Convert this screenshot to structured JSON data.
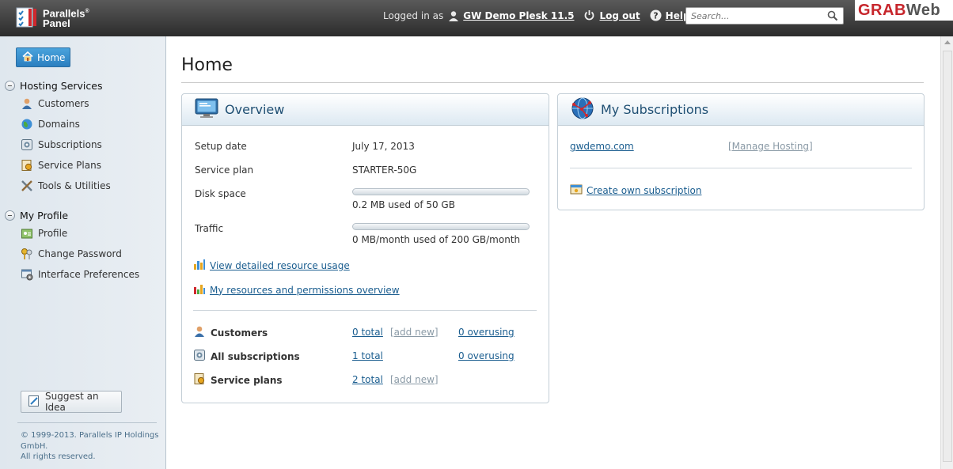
{
  "header": {
    "brand_line1": "Parallels",
    "brand_line2": "Panel",
    "logged_in_label": "Logged in as",
    "user_name": "GW Demo Plesk 11.5",
    "logout_label": "Log out",
    "help_label": "Help",
    "search_placeholder": "Search...",
    "watermark_a": "GRAB",
    "watermark_b": "Web"
  },
  "sidebar": {
    "home_label": "Home",
    "groups": [
      {
        "title": "Hosting Services",
        "items": [
          {
            "label": "Customers",
            "icon": "customer-icon"
          },
          {
            "label": "Domains",
            "icon": "globe-icon"
          },
          {
            "label": "Subscriptions",
            "icon": "subscription-icon"
          },
          {
            "label": "Service Plans",
            "icon": "plan-icon"
          },
          {
            "label": "Tools & Utilities",
            "icon": "tools-icon"
          }
        ]
      },
      {
        "title": "My Profile",
        "items": [
          {
            "label": "Profile",
            "icon": "profile-icon"
          },
          {
            "label": "Change Password",
            "icon": "keys-icon"
          },
          {
            "label": "Interface Preferences",
            "icon": "preferences-icon"
          }
        ]
      }
    ],
    "suggest_label": "Suggest an Idea",
    "copyright_line1": "© 1999-2013. Parallels IP Holdings",
    "copyright_line2": "GmbH.",
    "copyright_line3": "All rights reserved."
  },
  "main": {
    "title": "Home",
    "overview": {
      "title": "Overview",
      "setup_date_label": "Setup date",
      "setup_date_value": "July 17, 2013",
      "service_plan_label": "Service plan",
      "service_plan_value": "STARTER-50G",
      "disk_label": "Disk space",
      "disk_value": "0.2 MB used of 50 GB",
      "disk_fraction": 0.0,
      "traffic_label": "Traffic",
      "traffic_value": "0 MB/month used of 200 GB/month",
      "traffic_fraction": 0.0,
      "link_resource_usage": "View detailed resource usage",
      "link_permissions": "My resources and permissions overview",
      "summary": [
        {
          "label": "Customers",
          "total": "0 total",
          "add": "[add new]",
          "overusing": "0 overusing"
        },
        {
          "label": "All subscriptions",
          "total": "1 total",
          "add": "",
          "overusing": "0 overusing"
        },
        {
          "label": "Service plans",
          "total": "2 total",
          "add": "[add new]",
          "overusing": ""
        }
      ]
    },
    "subscriptions": {
      "title": "My Subscriptions",
      "domain": "gwdemo.com",
      "manage_label": "[Manage Hosting]",
      "create_label": "Create own subscription"
    }
  }
}
